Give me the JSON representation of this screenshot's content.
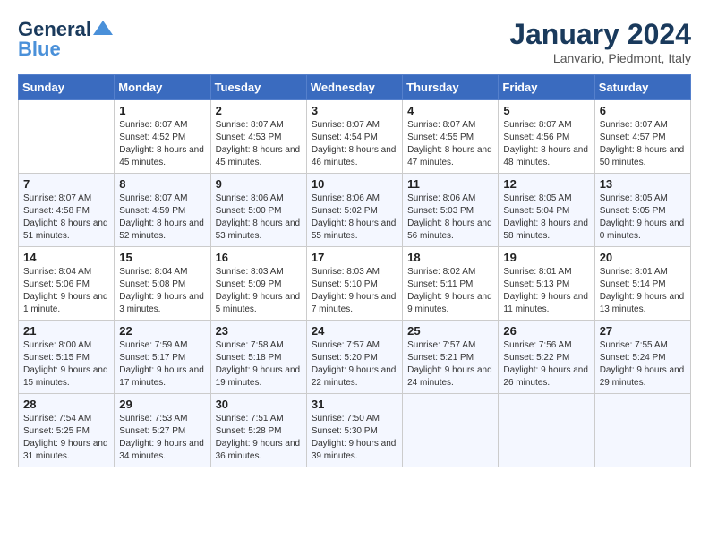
{
  "header": {
    "logo_line1": "General",
    "logo_line2": "Blue",
    "month": "January 2024",
    "location": "Lanvario, Piedmont, Italy"
  },
  "days_of_week": [
    "Sunday",
    "Monday",
    "Tuesday",
    "Wednesday",
    "Thursday",
    "Friday",
    "Saturday"
  ],
  "weeks": [
    [
      {
        "day": "",
        "sunrise": "",
        "sunset": "",
        "daylight": ""
      },
      {
        "day": "1",
        "sunrise": "Sunrise: 8:07 AM",
        "sunset": "Sunset: 4:52 PM",
        "daylight": "Daylight: 8 hours and 45 minutes."
      },
      {
        "day": "2",
        "sunrise": "Sunrise: 8:07 AM",
        "sunset": "Sunset: 4:53 PM",
        "daylight": "Daylight: 8 hours and 45 minutes."
      },
      {
        "day": "3",
        "sunrise": "Sunrise: 8:07 AM",
        "sunset": "Sunset: 4:54 PM",
        "daylight": "Daylight: 8 hours and 46 minutes."
      },
      {
        "day": "4",
        "sunrise": "Sunrise: 8:07 AM",
        "sunset": "Sunset: 4:55 PM",
        "daylight": "Daylight: 8 hours and 47 minutes."
      },
      {
        "day": "5",
        "sunrise": "Sunrise: 8:07 AM",
        "sunset": "Sunset: 4:56 PM",
        "daylight": "Daylight: 8 hours and 48 minutes."
      },
      {
        "day": "6",
        "sunrise": "Sunrise: 8:07 AM",
        "sunset": "Sunset: 4:57 PM",
        "daylight": "Daylight: 8 hours and 50 minutes."
      }
    ],
    [
      {
        "day": "7",
        "sunrise": "Sunrise: 8:07 AM",
        "sunset": "Sunset: 4:58 PM",
        "daylight": "Daylight: 8 hours and 51 minutes."
      },
      {
        "day": "8",
        "sunrise": "Sunrise: 8:07 AM",
        "sunset": "Sunset: 4:59 PM",
        "daylight": "Daylight: 8 hours and 52 minutes."
      },
      {
        "day": "9",
        "sunrise": "Sunrise: 8:06 AM",
        "sunset": "Sunset: 5:00 PM",
        "daylight": "Daylight: 8 hours and 53 minutes."
      },
      {
        "day": "10",
        "sunrise": "Sunrise: 8:06 AM",
        "sunset": "Sunset: 5:02 PM",
        "daylight": "Daylight: 8 hours and 55 minutes."
      },
      {
        "day": "11",
        "sunrise": "Sunrise: 8:06 AM",
        "sunset": "Sunset: 5:03 PM",
        "daylight": "Daylight: 8 hours and 56 minutes."
      },
      {
        "day": "12",
        "sunrise": "Sunrise: 8:05 AM",
        "sunset": "Sunset: 5:04 PM",
        "daylight": "Daylight: 8 hours and 58 minutes."
      },
      {
        "day": "13",
        "sunrise": "Sunrise: 8:05 AM",
        "sunset": "Sunset: 5:05 PM",
        "daylight": "Daylight: 9 hours and 0 minutes."
      }
    ],
    [
      {
        "day": "14",
        "sunrise": "Sunrise: 8:04 AM",
        "sunset": "Sunset: 5:06 PM",
        "daylight": "Daylight: 9 hours and 1 minute."
      },
      {
        "day": "15",
        "sunrise": "Sunrise: 8:04 AM",
        "sunset": "Sunset: 5:08 PM",
        "daylight": "Daylight: 9 hours and 3 minutes."
      },
      {
        "day": "16",
        "sunrise": "Sunrise: 8:03 AM",
        "sunset": "Sunset: 5:09 PM",
        "daylight": "Daylight: 9 hours and 5 minutes."
      },
      {
        "day": "17",
        "sunrise": "Sunrise: 8:03 AM",
        "sunset": "Sunset: 5:10 PM",
        "daylight": "Daylight: 9 hours and 7 minutes."
      },
      {
        "day": "18",
        "sunrise": "Sunrise: 8:02 AM",
        "sunset": "Sunset: 5:11 PM",
        "daylight": "Daylight: 9 hours and 9 minutes."
      },
      {
        "day": "19",
        "sunrise": "Sunrise: 8:01 AM",
        "sunset": "Sunset: 5:13 PM",
        "daylight": "Daylight: 9 hours and 11 minutes."
      },
      {
        "day": "20",
        "sunrise": "Sunrise: 8:01 AM",
        "sunset": "Sunset: 5:14 PM",
        "daylight": "Daylight: 9 hours and 13 minutes."
      }
    ],
    [
      {
        "day": "21",
        "sunrise": "Sunrise: 8:00 AM",
        "sunset": "Sunset: 5:15 PM",
        "daylight": "Daylight: 9 hours and 15 minutes."
      },
      {
        "day": "22",
        "sunrise": "Sunrise: 7:59 AM",
        "sunset": "Sunset: 5:17 PM",
        "daylight": "Daylight: 9 hours and 17 minutes."
      },
      {
        "day": "23",
        "sunrise": "Sunrise: 7:58 AM",
        "sunset": "Sunset: 5:18 PM",
        "daylight": "Daylight: 9 hours and 19 minutes."
      },
      {
        "day": "24",
        "sunrise": "Sunrise: 7:57 AM",
        "sunset": "Sunset: 5:20 PM",
        "daylight": "Daylight: 9 hours and 22 minutes."
      },
      {
        "day": "25",
        "sunrise": "Sunrise: 7:57 AM",
        "sunset": "Sunset: 5:21 PM",
        "daylight": "Daylight: 9 hours and 24 minutes."
      },
      {
        "day": "26",
        "sunrise": "Sunrise: 7:56 AM",
        "sunset": "Sunset: 5:22 PM",
        "daylight": "Daylight: 9 hours and 26 minutes."
      },
      {
        "day": "27",
        "sunrise": "Sunrise: 7:55 AM",
        "sunset": "Sunset: 5:24 PM",
        "daylight": "Daylight: 9 hours and 29 minutes."
      }
    ],
    [
      {
        "day": "28",
        "sunrise": "Sunrise: 7:54 AM",
        "sunset": "Sunset: 5:25 PM",
        "daylight": "Daylight: 9 hours and 31 minutes."
      },
      {
        "day": "29",
        "sunrise": "Sunrise: 7:53 AM",
        "sunset": "Sunset: 5:27 PM",
        "daylight": "Daylight: 9 hours and 34 minutes."
      },
      {
        "day": "30",
        "sunrise": "Sunrise: 7:51 AM",
        "sunset": "Sunset: 5:28 PM",
        "daylight": "Daylight: 9 hours and 36 minutes."
      },
      {
        "day": "31",
        "sunrise": "Sunrise: 7:50 AM",
        "sunset": "Sunset: 5:30 PM",
        "daylight": "Daylight: 9 hours and 39 minutes."
      },
      {
        "day": "",
        "sunrise": "",
        "sunset": "",
        "daylight": ""
      },
      {
        "day": "",
        "sunrise": "",
        "sunset": "",
        "daylight": ""
      },
      {
        "day": "",
        "sunrise": "",
        "sunset": "",
        "daylight": ""
      }
    ]
  ]
}
